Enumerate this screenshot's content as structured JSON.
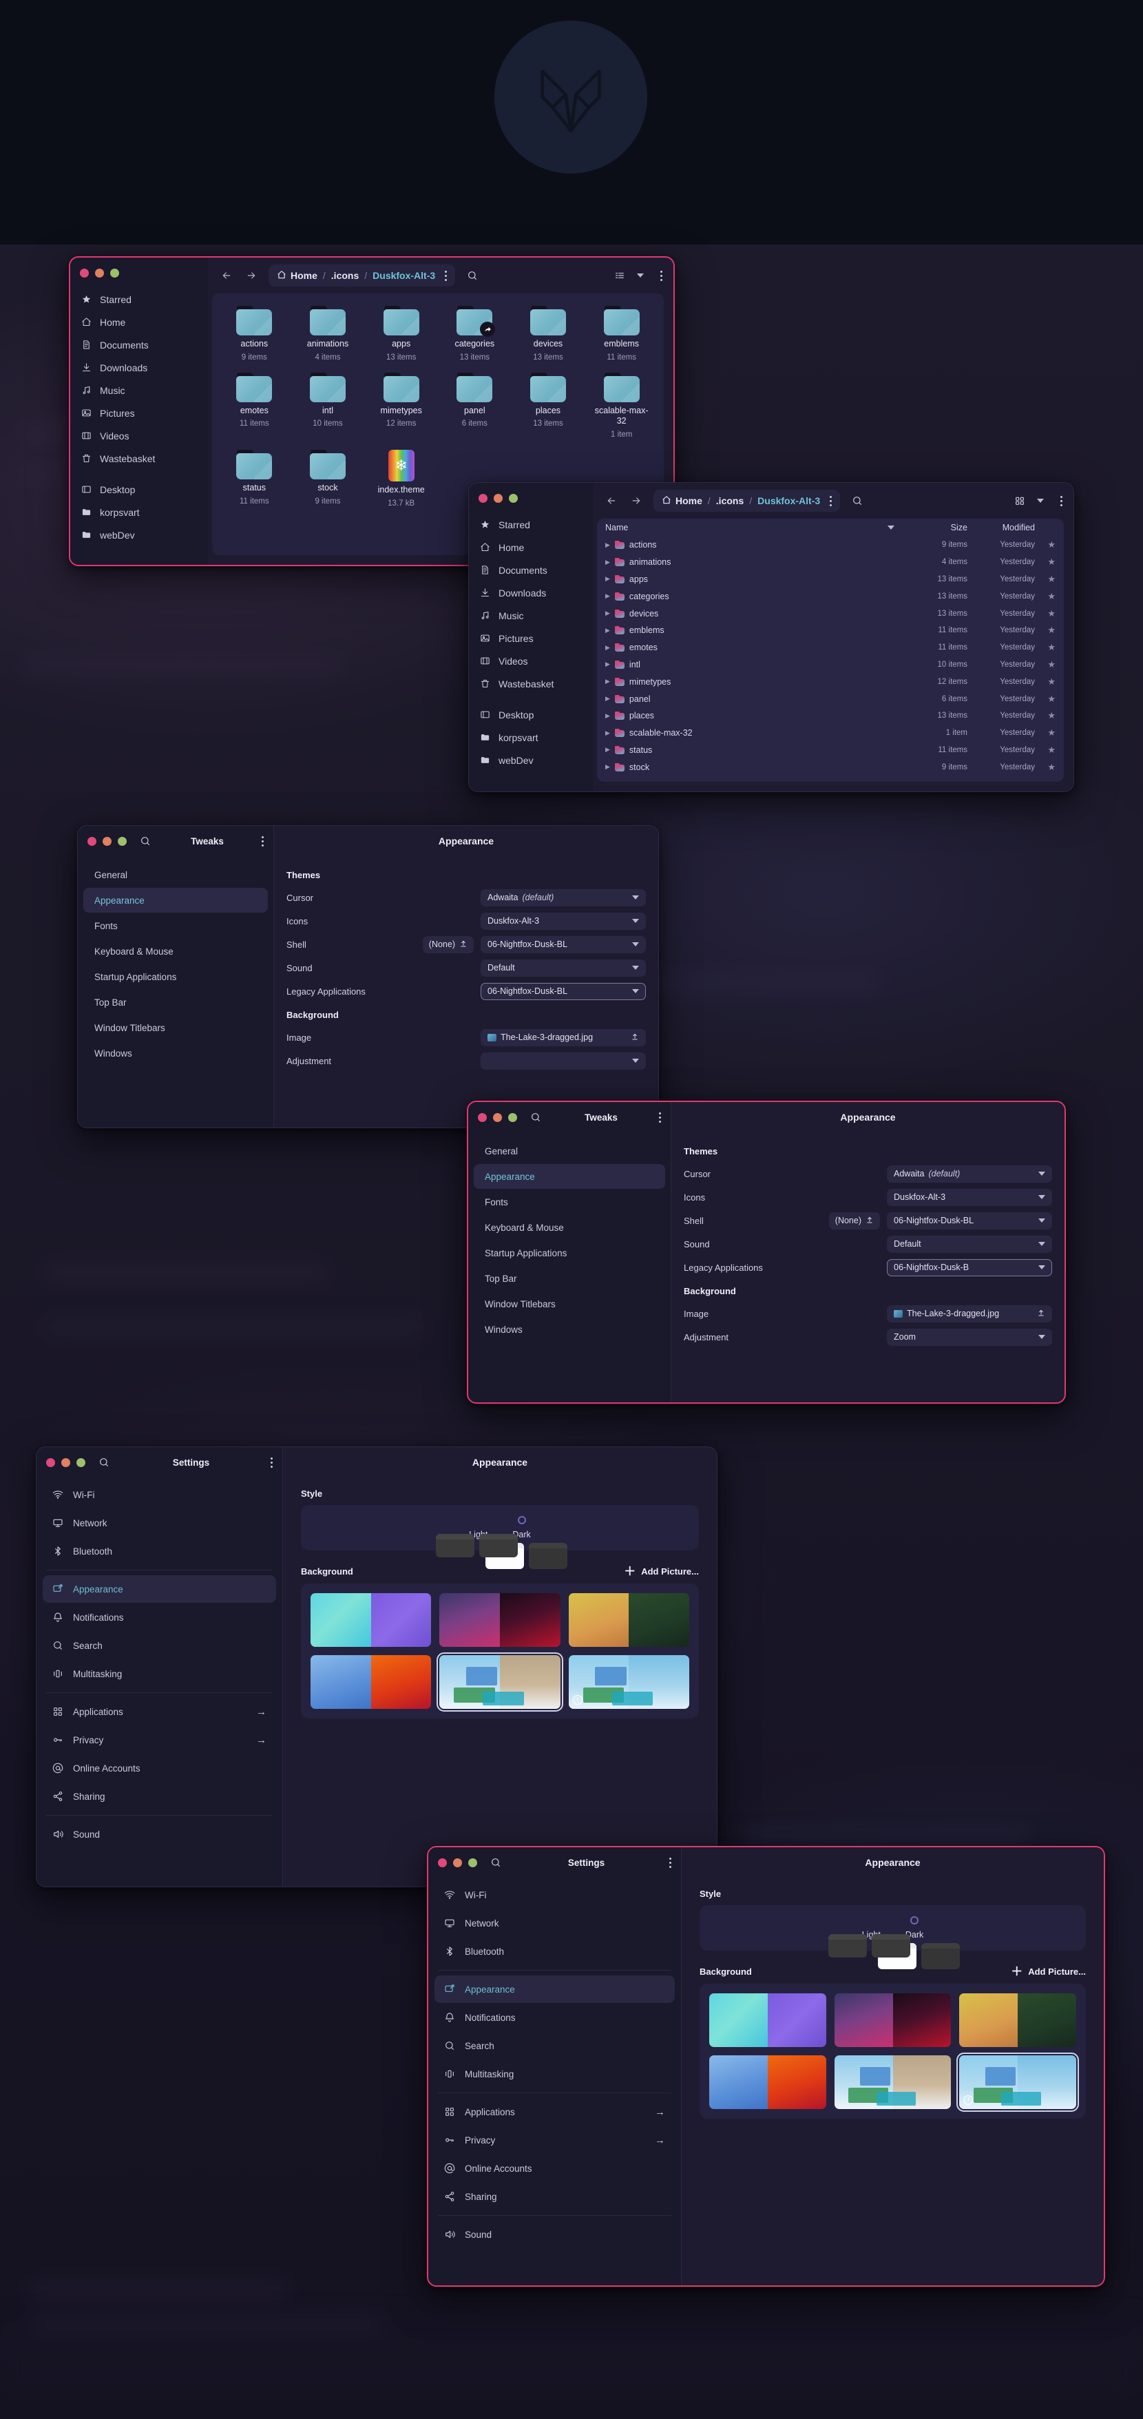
{
  "desktop": {
    "logo_name": "fox-head-logo"
  },
  "file_manager_grid": {
    "title_bar": {
      "back_icon": "arrow-left-icon",
      "forward_icon": "arrow-right-icon",
      "home_label": "Home",
      "crumb2": ".icons",
      "crumb3": "Duskfox-Alt-3",
      "sep": "/",
      "search_icon": "search-icon",
      "view_icon": "list-view-icon",
      "menu_icon": "kebab-menu-icon"
    },
    "sidebar": [
      {
        "label": "Starred",
        "icon": "star-icon"
      },
      {
        "label": "Home",
        "icon": "home-icon"
      },
      {
        "label": "Documents",
        "icon": "document-icon"
      },
      {
        "label": "Downloads",
        "icon": "download-icon"
      },
      {
        "label": "Music",
        "icon": "music-icon"
      },
      {
        "label": "Pictures",
        "icon": "picture-icon"
      },
      {
        "label": "Videos",
        "icon": "video-icon"
      },
      {
        "label": "Wastebasket",
        "icon": "trash-icon"
      },
      {
        "label": "Desktop",
        "icon": "desktop-icon",
        "gap_before": true
      },
      {
        "label": "korpsvart",
        "icon": "folder-icon"
      },
      {
        "label": "webDev",
        "icon": "folder-icon"
      }
    ],
    "items": [
      {
        "name": "actions",
        "sub": "9 items",
        "kind": "folder"
      },
      {
        "name": "animations",
        "sub": "4 items",
        "kind": "folder"
      },
      {
        "name": "apps",
        "sub": "13 items",
        "kind": "folder"
      },
      {
        "name": "categories",
        "sub": "13 items",
        "kind": "folder",
        "link": true
      },
      {
        "name": "devices",
        "sub": "13 items",
        "kind": "folder"
      },
      {
        "name": "emblems",
        "sub": "11 items",
        "kind": "folder"
      },
      {
        "name": "emotes",
        "sub": "11 items",
        "kind": "folder"
      },
      {
        "name": "intl",
        "sub": "10 items",
        "kind": "folder"
      },
      {
        "name": "mimetypes",
        "sub": "12 items",
        "kind": "folder"
      },
      {
        "name": "panel",
        "sub": "6 items",
        "kind": "folder"
      },
      {
        "name": "places",
        "sub": "13 items",
        "kind": "folder"
      },
      {
        "name": "scalable-max-32",
        "sub": "1 item",
        "kind": "folder"
      },
      {
        "name": "status",
        "sub": "11 items",
        "kind": "folder"
      },
      {
        "name": "stock",
        "sub": "9 items",
        "kind": "folder"
      },
      {
        "name": "index.theme",
        "sub": "13.7 kB",
        "kind": "theme-file"
      }
    ]
  },
  "file_manager_list": {
    "title_bar": {
      "home_label": "Home",
      "crumb2": ".icons",
      "crumb3": "Duskfox-Alt-3",
      "sep": "/"
    },
    "sidebar": [
      {
        "label": "Starred",
        "icon": "star-icon"
      },
      {
        "label": "Home",
        "icon": "home-icon"
      },
      {
        "label": "Documents",
        "icon": "document-icon"
      },
      {
        "label": "Downloads",
        "icon": "download-icon"
      },
      {
        "label": "Music",
        "icon": "music-icon"
      },
      {
        "label": "Pictures",
        "icon": "picture-icon"
      },
      {
        "label": "Videos",
        "icon": "video-icon"
      },
      {
        "label": "Wastebasket",
        "icon": "trash-icon"
      },
      {
        "label": "Desktop",
        "icon": "desktop-icon",
        "gap_before": true
      },
      {
        "label": "korpsvart",
        "icon": "folder-icon"
      },
      {
        "label": "webDev",
        "icon": "folder-icon"
      }
    ],
    "columns": {
      "name": "Name",
      "size": "Size",
      "modified": "Modified"
    },
    "rows": [
      {
        "name": "actions",
        "size": "9 items",
        "modified": "Yesterday"
      },
      {
        "name": "animations",
        "size": "4 items",
        "modified": "Yesterday"
      },
      {
        "name": "apps",
        "size": "13 items",
        "modified": "Yesterday"
      },
      {
        "name": "categories",
        "size": "13 items",
        "modified": "Yesterday"
      },
      {
        "name": "devices",
        "size": "13 items",
        "modified": "Yesterday"
      },
      {
        "name": "emblems",
        "size": "11 items",
        "modified": "Yesterday"
      },
      {
        "name": "emotes",
        "size": "11 items",
        "modified": "Yesterday"
      },
      {
        "name": "intl",
        "size": "10 items",
        "modified": "Yesterday"
      },
      {
        "name": "mimetypes",
        "size": "12 items",
        "modified": "Yesterday"
      },
      {
        "name": "panel",
        "size": "6 items",
        "modified": "Yesterday"
      },
      {
        "name": "places",
        "size": "13 items",
        "modified": "Yesterday"
      },
      {
        "name": "scalable-max-32",
        "size": "1 item",
        "modified": "Yesterday"
      },
      {
        "name": "status",
        "size": "11 items",
        "modified": "Yesterday"
      },
      {
        "name": "stock",
        "size": "9 items",
        "modified": "Yesterday"
      }
    ]
  },
  "tweaks_a": {
    "app_title": "Tweaks",
    "page_title": "Appearance",
    "sidebar": [
      "General",
      "Appearance",
      "Fonts",
      "Keyboard & Mouse",
      "Startup Applications",
      "Top Bar",
      "Window Titlebars",
      "Windows"
    ],
    "selected_sidebar": "Appearance",
    "themes_heading": "Themes",
    "background_heading": "Background",
    "rows": [
      {
        "label": "Cursor",
        "value": "Adwaita ",
        "value_em": "(default)"
      },
      {
        "label": "Icons",
        "value": "Duskfox-Alt-3"
      },
      {
        "label": "Shell",
        "chip": "(None)",
        "value": "06-Nightfox-Dusk-BL"
      },
      {
        "label": "Sound",
        "value": "Default"
      },
      {
        "label": "Legacy Applications",
        "value": "06-Nightfox-Dusk-BL",
        "focused": true
      }
    ],
    "bg_rows": [
      {
        "label": "Image",
        "value": "The-Lake-3-dragged.jpg"
      },
      {
        "label": "Adjustment",
        "value": ""
      }
    ]
  },
  "tweaks_b": {
    "app_title": "Tweaks",
    "page_title": "Appearance",
    "sidebar": [
      "General",
      "Appearance",
      "Fonts",
      "Keyboard & Mouse",
      "Startup Applications",
      "Top Bar",
      "Window Titlebars",
      "Windows"
    ],
    "selected_sidebar": "Appearance",
    "themes_heading": "Themes",
    "background_heading": "Background",
    "rows": [
      {
        "label": "Cursor",
        "value": "Adwaita ",
        "value_em": "(default)"
      },
      {
        "label": "Icons",
        "value": "Duskfox-Alt-3"
      },
      {
        "label": "Shell",
        "chip": "(None)",
        "value": "06-Nightfox-Dusk-BL"
      },
      {
        "label": "Sound",
        "value": "Default"
      },
      {
        "label": "Legacy Applications",
        "value": "06-Nightfox-Dusk-B",
        "focused": true
      }
    ],
    "bg_rows": [
      {
        "label": "Image",
        "value": "The-Lake-3-dragged.jpg"
      },
      {
        "label": "Adjustment",
        "value": "Zoom"
      }
    ]
  },
  "settings_a": {
    "app_title": "Settings",
    "page_title": "Appearance",
    "sidebar": [
      {
        "label": "Wi-Fi",
        "icon": "wifi-icon"
      },
      {
        "label": "Network",
        "icon": "network-icon"
      },
      {
        "label": "Bluetooth",
        "icon": "bluetooth-icon"
      },
      {
        "label": "Appearance",
        "icon": "appearance-icon",
        "selected": true,
        "divider_before": true
      },
      {
        "label": "Notifications",
        "icon": "bell-icon"
      },
      {
        "label": "Search",
        "icon": "search-icon"
      },
      {
        "label": "Multitasking",
        "icon": "multitasking-icon"
      },
      {
        "label": "Applications",
        "icon": "apps-grid-icon",
        "arrow": "→",
        "divider_before": true
      },
      {
        "label": "Privacy",
        "icon": "key-icon",
        "arrow": "→"
      },
      {
        "label": "Online Accounts",
        "icon": "at-icon"
      },
      {
        "label": "Sharing",
        "icon": "share-icon"
      },
      {
        "label": "Sound",
        "icon": "speaker-icon",
        "divider_before": true
      }
    ],
    "style_heading": "Style",
    "style_options": [
      {
        "label": "Light",
        "selected": false
      },
      {
        "label": "Dark",
        "selected": true
      }
    ],
    "background_heading": "Background",
    "add_picture_label": "Add Picture...",
    "wallpapers": [
      {
        "left": "w-teal",
        "right": "w-purple",
        "selected": false
      },
      {
        "left": "w-plum",
        "right": "w-wine",
        "selected": false
      },
      {
        "left": "w-gold",
        "right": "w-forest",
        "selected": false
      },
      {
        "left": "w-blue",
        "right": "w-fire",
        "selected": false
      },
      {
        "left": "w-sky1",
        "right": "w-sand",
        "selected": true,
        "scene": true
      },
      {
        "left": "w-sky2",
        "right": "w-sky3",
        "selected": false,
        "scene": true,
        "clock": true
      }
    ]
  },
  "settings_b": {
    "app_title": "Settings",
    "page_title": "Appearance",
    "sidebar": [
      {
        "label": "Wi-Fi",
        "icon": "wifi-icon"
      },
      {
        "label": "Network",
        "icon": "network-icon"
      },
      {
        "label": "Bluetooth",
        "icon": "bluetooth-icon"
      },
      {
        "label": "Appearance",
        "icon": "appearance-icon",
        "selected": true,
        "divider_before": true
      },
      {
        "label": "Notifications",
        "icon": "bell-icon"
      },
      {
        "label": "Search",
        "icon": "search-icon"
      },
      {
        "label": "Multitasking",
        "icon": "multitasking-icon"
      },
      {
        "label": "Applications",
        "icon": "apps-grid-icon",
        "arrow": "→",
        "divider_before": true
      },
      {
        "label": "Privacy",
        "icon": "key-icon",
        "arrow": "→"
      },
      {
        "label": "Online Accounts",
        "icon": "at-icon"
      },
      {
        "label": "Sharing",
        "icon": "share-icon"
      },
      {
        "label": "Sound",
        "icon": "speaker-icon",
        "divider_before": true
      }
    ],
    "style_heading": "Style",
    "style_options": [
      {
        "label": "Light",
        "selected": false
      },
      {
        "label": "Dark",
        "selected": true
      }
    ],
    "background_heading": "Background",
    "add_picture_label": "Add Picture...",
    "wallpapers": [
      {
        "left": "w-teal",
        "right": "w-purple",
        "selected": false
      },
      {
        "left": "w-plum",
        "right": "w-wine",
        "selected": false
      },
      {
        "left": "w-gold",
        "right": "w-forest",
        "selected": false
      },
      {
        "left": "w-blue",
        "right": "w-fire",
        "selected": false
      },
      {
        "left": "w-sky1",
        "right": "w-sand",
        "selected": false,
        "scene": true
      },
      {
        "left": "w-sky2",
        "right": "w-sky3",
        "selected": true,
        "scene": true,
        "clock": true
      }
    ]
  },
  "colors": {
    "accent_border": "#e4376f",
    "window_bg": "#1c1a2e",
    "sidebar_bg": "#1a182b",
    "panel_bg": "#252240",
    "selected_text": "#6fc3d6",
    "folder_blue": "#73b4c6"
  }
}
